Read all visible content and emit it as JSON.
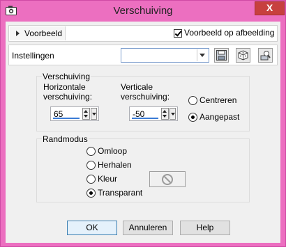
{
  "window": {
    "title": "Verschuiving",
    "close_label": "X"
  },
  "preview": {
    "toggle_label": "Voorbeeld",
    "checkbox_label": "Voorbeeld op afbeelding",
    "checked": true
  },
  "settings": {
    "label": "Instellingen",
    "preset_value": ""
  },
  "offset": {
    "group_label": "Verschuiving",
    "horizontal": {
      "label_line1": "Horizontale",
      "label_line2": "verschuiving:",
      "value": "65"
    },
    "vertical": {
      "label_line1": "Verticale",
      "label_line2": "verschuiving:",
      "value": "-50"
    },
    "options": [
      {
        "label": "Centreren",
        "checked": false
      },
      {
        "label": "Aangepast",
        "checked": true
      }
    ]
  },
  "edge_mode": {
    "group_label": "Randmodus",
    "options": [
      {
        "label": "Omloop",
        "checked": false
      },
      {
        "label": "Herhalen",
        "checked": false
      },
      {
        "label": "Kleur",
        "checked": false
      },
      {
        "label": "Transparant",
        "checked": true
      }
    ]
  },
  "buttons": {
    "ok": "OK",
    "cancel": "Annuleren",
    "help": "Help"
  },
  "icons": [
    "camera-icon",
    "save-preset-icon",
    "dice-icon",
    "manage-presets-icon",
    "no-color-icon"
  ]
}
